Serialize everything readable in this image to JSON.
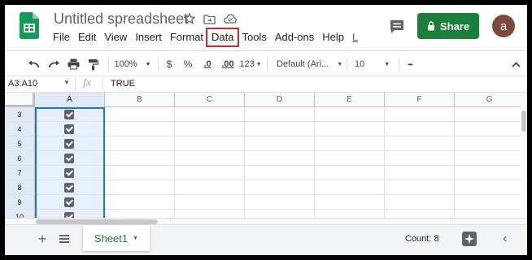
{
  "header": {
    "doc_title": "Untitled spreadsheet",
    "title_icons": [
      "star-icon",
      "folder-move-icon",
      "cloud-status-icon"
    ],
    "menu": [
      "File",
      "Edit",
      "View",
      "Insert",
      "Format",
      "Data",
      "Tools",
      "Add-ons",
      "Help",
      "L"
    ],
    "highlighted_menu": "Data",
    "share_label": "Share",
    "avatar_letter": "a",
    "share_color": "#188038",
    "highlight_color": "#d9252a"
  },
  "toolbar": {
    "zoom": "100%",
    "currency": "$",
    "percent": "%",
    "decimal_decrease": ".0",
    "decimal_increase": ".00",
    "more_formats": "123",
    "font": "Default (Ari...",
    "font_size": "10",
    "more": "•••",
    "icons": [
      "undo-icon",
      "redo-icon",
      "print-icon",
      "paint-format-icon",
      "collapse-toolbar-icon"
    ]
  },
  "formula_bar": {
    "name_box": "A3:A10",
    "fx": "fx",
    "value": "TRUE"
  },
  "grid": {
    "columns": [
      "A",
      "B",
      "C",
      "D",
      "E",
      "F",
      "G"
    ],
    "rows": [
      "3",
      "4",
      "5",
      "6",
      "7",
      "8",
      "9",
      "10"
    ],
    "selected_column": "A",
    "checked_column": "A",
    "selection_color": "#1a73e8"
  },
  "bottom_bar": {
    "sheet_name": "Sheet1",
    "count": "Count: 8",
    "add_sheet": "+"
  }
}
